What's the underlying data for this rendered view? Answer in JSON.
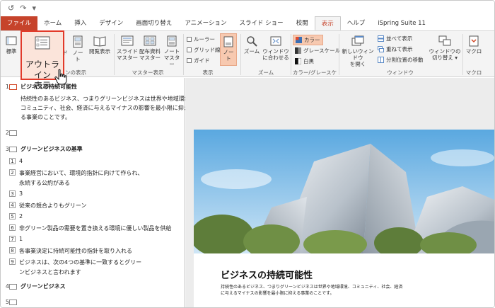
{
  "qat": {
    "undo": "↺",
    "redo": "↷",
    "more": "▾"
  },
  "tabs": [
    {
      "label": "ファイル"
    },
    {
      "label": "ホーム"
    },
    {
      "label": "挿入"
    },
    {
      "label": "デザイン"
    },
    {
      "label": "画面切り替え"
    },
    {
      "label": "アニメーション"
    },
    {
      "label": "スライド ショー"
    },
    {
      "label": "校閲"
    },
    {
      "label": "表示"
    },
    {
      "label": "ヘルプ"
    },
    {
      "label": "iSpring Suite 11"
    }
  ],
  "ribbon": {
    "standard": "標準",
    "outline_view_line1": "アウトライン",
    "outline_view_line2": "表示",
    "slide_sorter_frag": "ド",
    "notes_page_line1": "ノー",
    "notes_page_line2": "ト",
    "reading_view": "閲覧表示",
    "presentation_views_group": "ンの表示",
    "slide_master_line1": "スライド",
    "slide_master_line2": "マスター",
    "handout_master_line1": "配布資料",
    "handout_master_line2": "マスター",
    "notes_master_line1": "ノート",
    "notes_master_line2": "マスター",
    "master_views_group": "マスター表示",
    "ruler": "ルーラー",
    "gridlines": "グリッド線",
    "guides": "ガイド",
    "notes_toggle_line1": "ノー",
    "notes_toggle_line2": "ト",
    "show_group": "表示",
    "zoom": "ズーム",
    "fit_window_line1": "ウィンドウ",
    "fit_window_line2": "に合わせる",
    "zoom_group": "ズーム",
    "color": "カラー",
    "grayscale": "グレースケール",
    "bw": "白黒",
    "color_group": "カラー/グレースケール",
    "new_window_line1": "新しいウィンドウ",
    "new_window_line2": "を開く",
    "arrange_all": "並べて表示",
    "cascade": "重ねて表示",
    "move_split": "分割位置の移動",
    "switch_windows_line1": "ウィンドウの",
    "switch_windows_line2": "切り替え ▾",
    "window_group": "ウィンドウ",
    "macros": "マクロ",
    "macros_group": "マクロ"
  },
  "outline": {
    "s1_num": "1",
    "s1_title": "ビジネスの持続可能性",
    "s1_body_1": "持続性のあるビジネス、つまりグリーンビジネスは世界や地域環境、",
    "s1_body_2": "コミュニティ、社会、経済に与えるマイナスの影響を最小限に抑え",
    "s1_body_3": "る事業のことです。",
    "s2_num": "2",
    "s3_num": "3",
    "s3_title": "グリーンビジネスの基準",
    "items": [
      {
        "n": "1",
        "text": "4"
      },
      {
        "n": "2",
        "text": "事業経営において、環境的指針に向けて作られ、"
      },
      {
        "n": "",
        "text": "永続する公約がある"
      },
      {
        "n": "3",
        "text": "3"
      },
      {
        "n": "4",
        "text": "従来の競合よりもグリーン"
      },
      {
        "n": "5",
        "text": "2"
      },
      {
        "n": "6",
        "text": "非グリーン製品の需要を置き換える環境に優しい製品を供給"
      },
      {
        "n": "7",
        "text": "1"
      },
      {
        "n": "8",
        "text": "各事業決定に持続可能性の指針を取り入れる"
      },
      {
        "n": "9",
        "text": "ビジネスは、次の4つの基準に一致するとグリー"
      },
      {
        "n": "",
        "text": "ンビジネスと言われます"
      }
    ],
    "s4_num": "4",
    "s4_title": "グリーンビジネス",
    "s5_num": "5"
  },
  "slide": {
    "title": "ビジネスの持続可能性",
    "body": "持続性のあるビジネス、つまりグリーンビジネスは世界や地域環境、コミュニティ、社会、経済に与えるマイナスの影響を最小限に抑える事業のことです。"
  },
  "colors": {
    "accent": "#c6432b",
    "highlight": "#e23a2a",
    "highlight_fill": "#fbe4da"
  }
}
